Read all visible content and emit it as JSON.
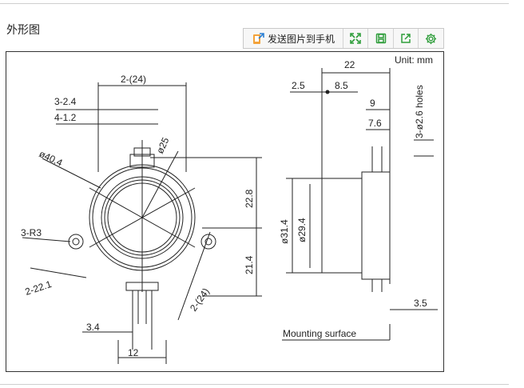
{
  "section": {
    "title": "外形图"
  },
  "toolbar": {
    "send_label": "发送图片到手机",
    "icons": [
      "send-to-phone-icon",
      "fullscreen-icon",
      "save-icon",
      "share-icon",
      "settings-icon"
    ],
    "accent_color": "#2e9d3a"
  },
  "drawing": {
    "unit_label": "Unit: mm",
    "front_view": {
      "dims": [
        "2-(24)",
        "3-2.4",
        "4-1.2",
        "ø40.4",
        "ø25",
        "22.8",
        "3-R3",
        "21.4",
        "2-22.1",
        "2-(24)",
        "3.4",
        "12"
      ]
    },
    "side_view": {
      "dims": [
        "22",
        "2.5",
        "8.5",
        "9",
        "7.6",
        "3-ø2.6 holes",
        "ø31.4",
        "ø29.4",
        "3.5"
      ],
      "mounting_label": "Mounting surface"
    }
  }
}
